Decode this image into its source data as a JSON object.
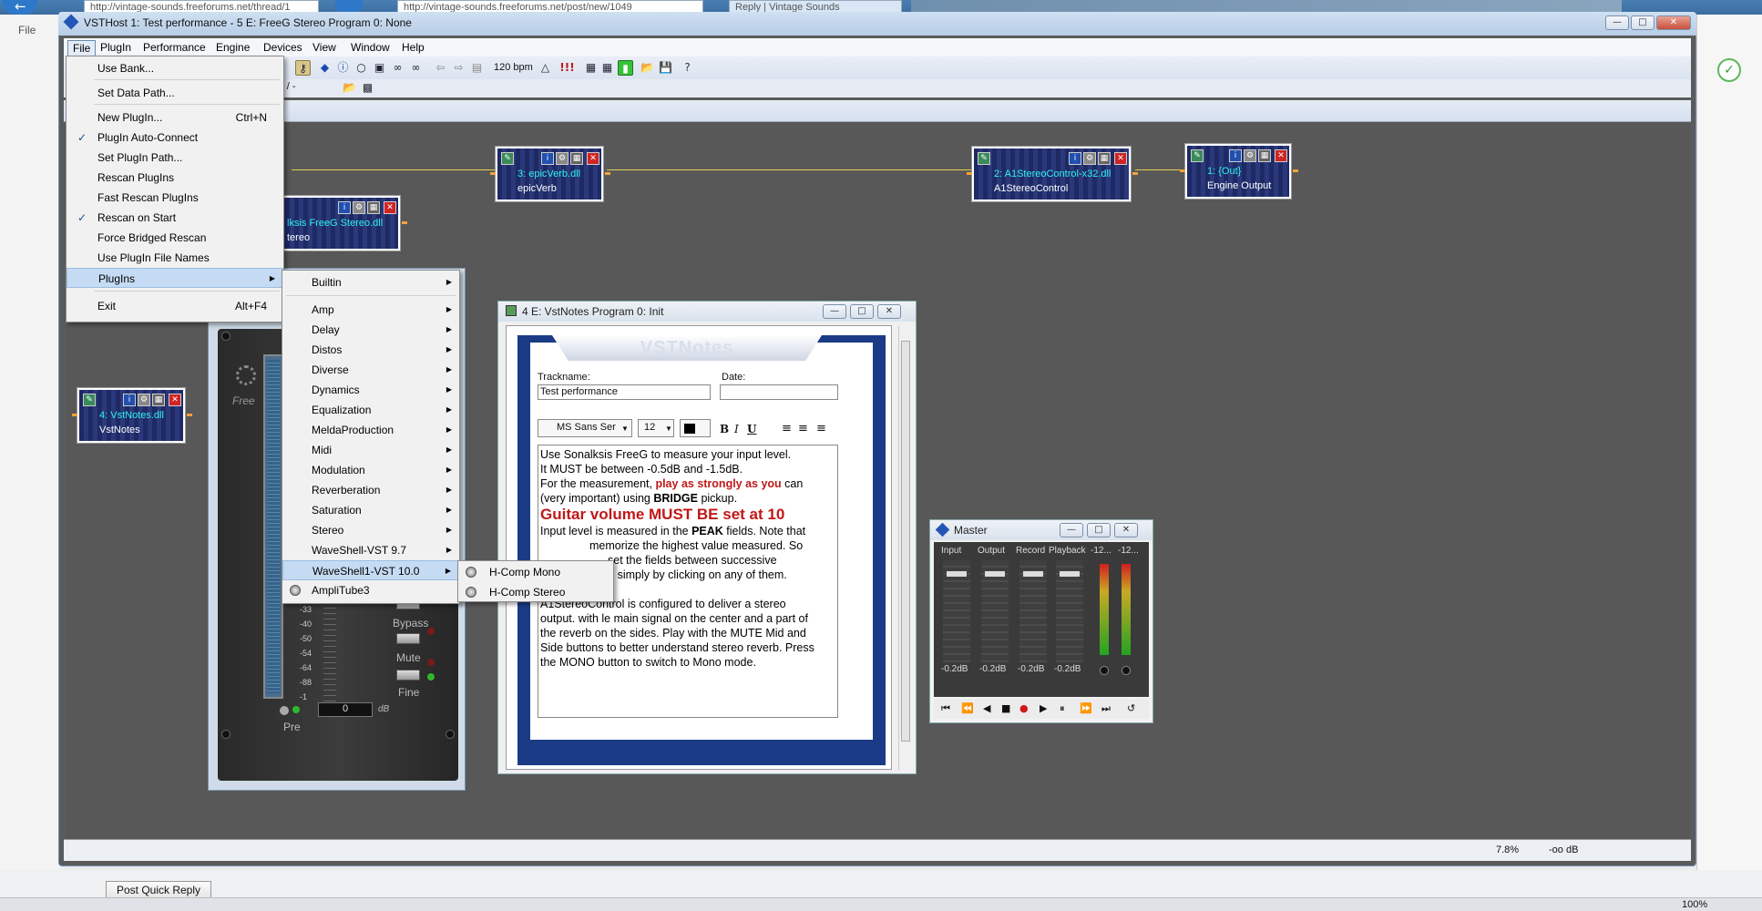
{
  "browser": {
    "tab1": "http://vintage-sounds.freeforums.net/thread/1",
    "tab2": "http://vintage-sounds.freeforums.net/post/new/1049",
    "tab3": "Reply | Vintage Sounds",
    "menu_file": "File",
    "post_quick_reply": "Post Quick Reply",
    "zoom": "100%"
  },
  "window": {
    "title": "VSTHost 1: Test performance - 5 E: FreeG Stereo Program 0: None",
    "menus": [
      "File",
      "PlugIn",
      "Performance",
      "Engine",
      "Devices",
      "View",
      "Window",
      "Help"
    ],
    "bpm": "120 bpm",
    "position": "- / -",
    "status_cpu": "7.8%",
    "status_db": "-oo dB"
  },
  "file_menu": {
    "items": [
      {
        "label": "Use Bank...",
        "shortcut": ""
      },
      {
        "label": "Set Data Path...",
        "shortcut": ""
      },
      {
        "label": "New PlugIn...",
        "shortcut": "Ctrl+N"
      },
      {
        "label": "PlugIn Auto-Connect",
        "checked": "✓"
      },
      {
        "label": "Set PlugIn Path..."
      },
      {
        "label": "Rescan PlugIns"
      },
      {
        "label": "Fast Rescan PlugIns"
      },
      {
        "label": "Rescan on Start",
        "checked": "✓"
      },
      {
        "label": "Force Bridged Rescan"
      },
      {
        "label": "Use PlugIn File Names"
      },
      {
        "label": "PlugIns"
      },
      {
        "label": "Exit",
        "shortcut": "Alt+F4"
      }
    ]
  },
  "plugins_menu": {
    "items": [
      "Builtin",
      "Amp",
      "Delay",
      "Distos",
      "Diverse",
      "Dynamics",
      "Equalization",
      "MeldaProduction",
      "Midi",
      "Modulation",
      "Reverberation",
      "Saturation",
      "Stereo",
      "WaveShell-VST 9.7",
      "WaveShell1-VST 10.0",
      "AmpliTube3"
    ]
  },
  "waveshell_menu": {
    "items": [
      "H-Comp Mono",
      "H-Comp Stereo"
    ]
  },
  "nodes": {
    "epicverb": {
      "title": "3: epicVerb.dll",
      "sub": "epicVerb"
    },
    "a1stereo": {
      "title": "2: A1StereoControl-x32.dll",
      "sub": "A1StereoControl"
    },
    "out": {
      "title": "1: {Out}",
      "sub": "Engine Output"
    },
    "freeg": {
      "title": "lksis FreeG Stereo.dll",
      "sub": "tereo"
    },
    "vstnotes": {
      "title": "4: VstNotes.dll",
      "sub": "VstNotes"
    }
  },
  "freeg_panel": {
    "free_label": "Free",
    "scale": [
      "-33",
      "-40",
      "-50",
      "-54",
      "-64",
      "-88",
      "-1"
    ],
    "bypass": "Bypass",
    "mute": "Mute",
    "fine": "Fine",
    "pre": "Pre",
    "value": "0",
    "unit": "dB"
  },
  "vstnotes_win": {
    "title": "4 E: VstNotes Program 0: Init",
    "header": "VSTNotes",
    "trackname_label": "Trackname:",
    "trackname_value": "Test performance",
    "date_label": "Date:",
    "font": "MS Sans Ser",
    "size": "12",
    "lines": [
      "Use Sonalksis FreeG to measure your input level.",
      "It MUST be between -0.5dB and -1.5dB.",
      "For the measurement, ",
      "play as strongly as you",
      " can",
      "(very important) using ",
      "BRIDGE",
      " pickup.",
      "Guitar volume MUST BE set at 10",
      "Input level is measured in the ",
      "PEAK",
      " fields. Note that",
      "memorize the highest value measured. So",
      "set the fields between successive",
      "ents, simply by clicking on any of them.",
      "A1StereoControl is configured to deliver a stereo",
      "output. with le main signal on the center and a part of",
      "the reverb on the sides. Play with the MUTE Mid and",
      "Side buttons to better understand stereo reverb. Press",
      "the MONO button to switch to Mono mode."
    ]
  },
  "master_win": {
    "title": "Master",
    "channels": [
      "Input",
      "Output",
      "Record",
      "Playback",
      "-12...",
      "-12..."
    ],
    "values": [
      "-0.2dB",
      "-0.2dB",
      "-0.2dB",
      "-0.2dB"
    ]
  }
}
